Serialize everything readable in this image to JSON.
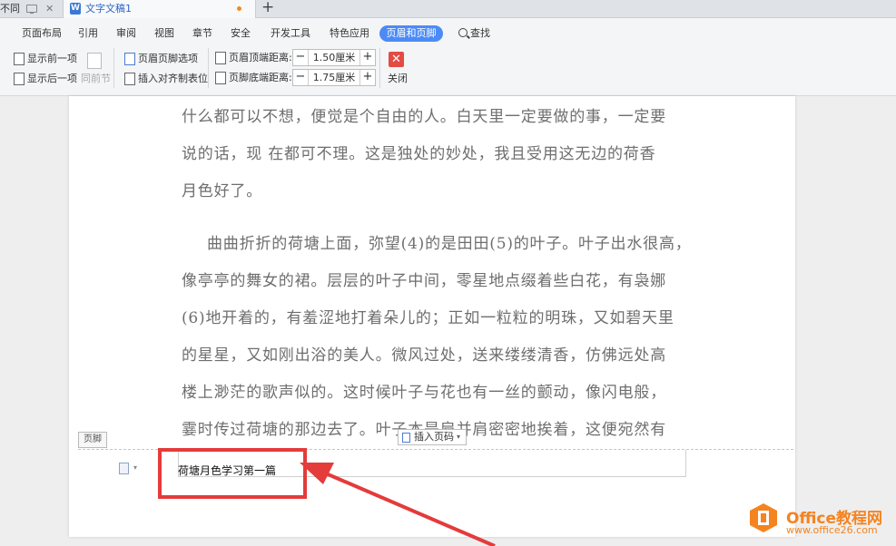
{
  "tabs": {
    "previous_tab_label": "不同",
    "active_tab_label": "文字文稿1",
    "active_tab_icon": "wps-writer-icon",
    "new_tab_label": "+"
  },
  "menu": {
    "items": [
      "页面布局",
      "引用",
      "审阅",
      "视图",
      "章节",
      "安全",
      "开发工具",
      "特色应用"
    ],
    "active_item": "页眉和页脚",
    "search_label": "查找"
  },
  "toolbar": {
    "show_prev_label": "显示前一项",
    "show_next_label": "显示后一项",
    "same_as_prev_label": "同前节",
    "header_footer_options_label": "页眉页脚选项",
    "insert_tab_label": "插入对齐制表位",
    "header_top_label": "页眉顶端距离:",
    "header_top_value": "1.50厘米",
    "footer_bottom_label": "页脚底端距离:",
    "footer_bottom_value": "1.75厘米",
    "close_label": "关闭",
    "minus_label": "−",
    "plus_label": "+"
  },
  "document": {
    "paragraph1_lines": [
      "什么都可以不想，便觉是个自由的人。白天里一定要做的事，一定要",
      "说的话，现 在都可不理。这是独处的妙处，我且受用这无边的荷香",
      "月色好了。"
    ],
    "paragraph2_lines": [
      "曲曲折折的荷塘上面，弥望(4)的是田田(5)的叶子。叶子出水很高，",
      "像亭亭的舞女的裙。层层的叶子中间，零星地点缀着些白花，有袅娜",
      "(6)地开着的，有羞涩地打着朵儿的；正如一粒粒的明珠，又如碧天里",
      "的星星，又如刚出浴的美人。微风过处，送来缕缕清香，仿佛远处高",
      "楼上渺茫的歌声似的。这时候叶子与花也有一丝的颤动，像闪电般，",
      "霎时传过荷塘的那边去了。叶子本是肩并肩密密地挨着，这便宛然有"
    ]
  },
  "footer": {
    "tag_label": "页脚",
    "insert_page_number_label": "插入页码",
    "text": "荷塘月色学习第一篇"
  },
  "watermark": {
    "brand": "Office教程网",
    "url": "www.office26.com"
  },
  "colors": {
    "accent": "#4c8bf5",
    "annotation_red": "#e43b3b",
    "brand_orange": "#f5831f"
  }
}
